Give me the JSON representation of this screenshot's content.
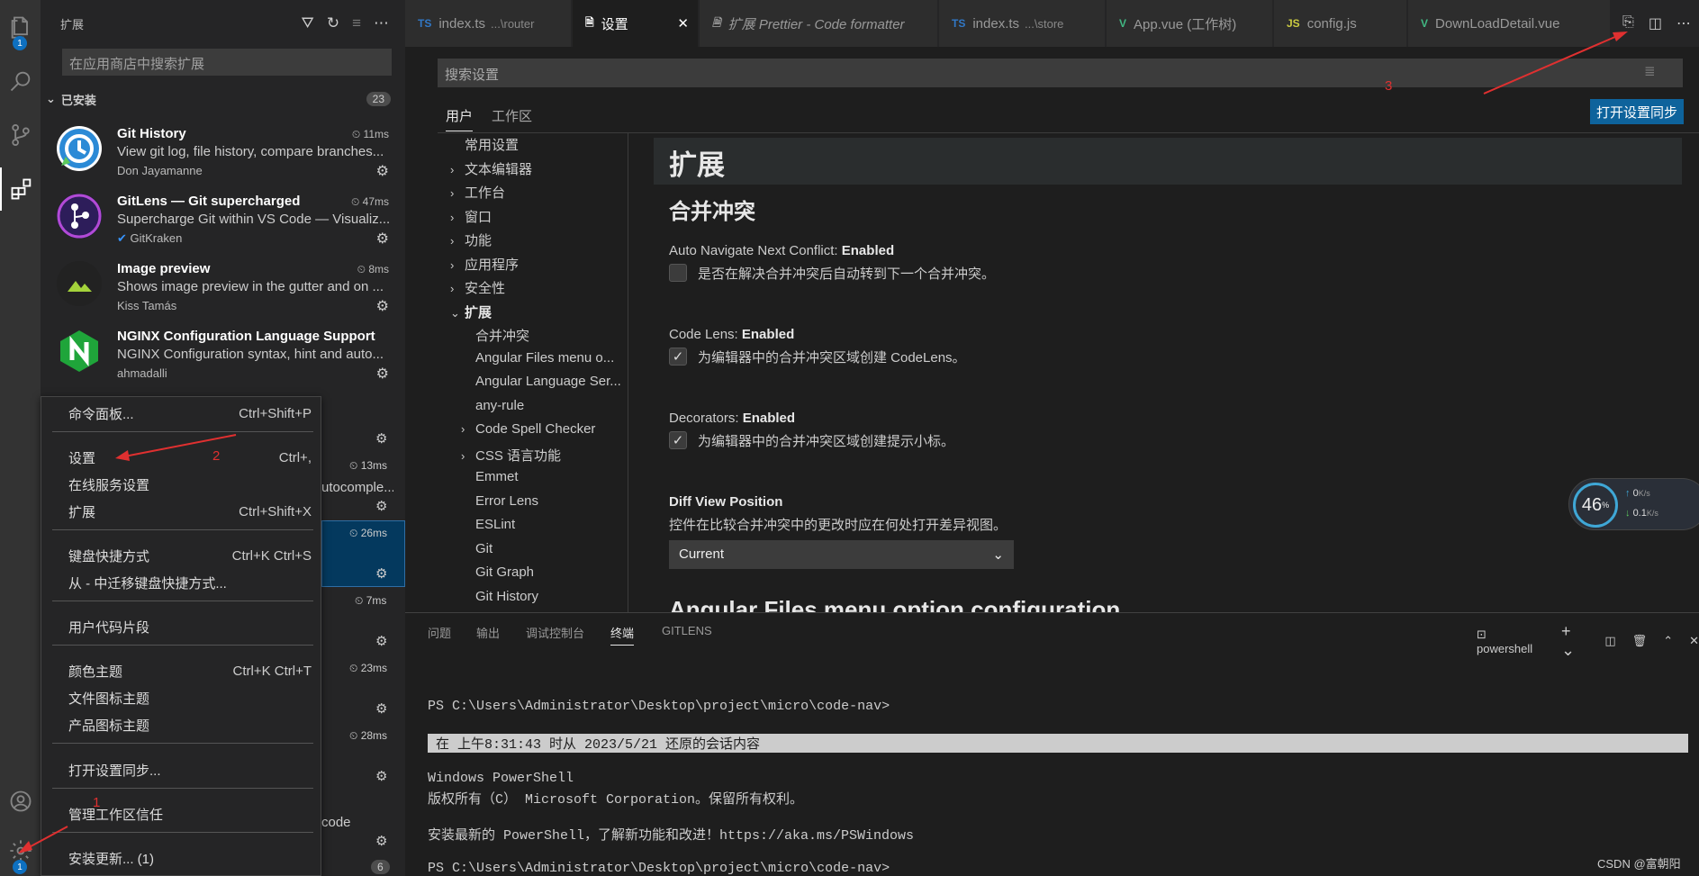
{
  "activity_bar": {
    "explorer_badge": "1",
    "settings_badge": "1"
  },
  "sidebar": {
    "title": "扩展",
    "search_placeholder": "在应用商店中搜索扩展",
    "installed_label": "已安装",
    "installed_count": "23",
    "bottom_count": "6",
    "extensions": [
      {
        "name": "Git History",
        "desc": "View git log, file history, compare branches...",
        "publisher": "Don Jayamanne",
        "time": "11ms"
      },
      {
        "name": "GitLens — Git supercharged",
        "desc": "Supercharge Git within VS Code — Visualiz...",
        "publisher": "GitKraken",
        "time": "47ms"
      },
      {
        "name": "Image preview",
        "desc": "Shows image preview in the gutter and on ...",
        "publisher": "Kiss Tamás",
        "time": "8ms"
      },
      {
        "name": "NGINX Configuration Language Support",
        "desc": "NGINX Configuration syntax, hint and auto...",
        "publisher": "ahmadalli",
        "time": ""
      }
    ],
    "partial_times": [
      "13ms",
      "26ms",
      "7ms",
      "23ms",
      "28ms"
    ],
    "partial_text_1": "utocomple...",
    "partial_text_2": "code"
  },
  "context_menu": {
    "items": [
      {
        "label": "命令面板...",
        "key": "Ctrl+Shift+P"
      },
      {
        "label": "设置",
        "key": "Ctrl+,"
      },
      {
        "label": "在线服务设置",
        "key": ""
      },
      {
        "label": "扩展",
        "key": "Ctrl+Shift+X"
      },
      {
        "label": "键盘快捷方式",
        "key": "Ctrl+K Ctrl+S"
      },
      {
        "label": "从 - 中迁移键盘快捷方式...",
        "key": ""
      },
      {
        "label": "用户代码片段",
        "key": ""
      },
      {
        "label": "颜色主题",
        "key": "Ctrl+K Ctrl+T"
      },
      {
        "label": "文件图标主题",
        "key": ""
      },
      {
        "label": "产品图标主题",
        "key": ""
      },
      {
        "label": "打开设置同步...",
        "key": ""
      },
      {
        "label": "管理工作区信任",
        "key": ""
      },
      {
        "label": "安装更新... (1)",
        "key": ""
      }
    ]
  },
  "tabs": [
    {
      "icon": "TS",
      "label": "index.ts",
      "sub": "...\\router"
    },
    {
      "icon": "",
      "label": "设置",
      "sub": ""
    },
    {
      "icon": "",
      "label": "扩展 Prettier - Code formatter",
      "sub": ""
    },
    {
      "icon": "TS",
      "label": "index.ts",
      "sub": "...\\store"
    },
    {
      "icon": "V",
      "label": "App.vue (工作树)",
      "sub": ""
    },
    {
      "icon": "JS",
      "label": "config.js",
      "sub": ""
    },
    {
      "icon": "V",
      "label": "DownLoadDetail.vue",
      "sub": ""
    }
  ],
  "settings": {
    "search_placeholder": "搜索设置",
    "scope_user": "用户",
    "scope_workspace": "工作区",
    "sync_button": "打开设置同步",
    "toc": [
      {
        "label": "常用设置",
        "chev": ""
      },
      {
        "label": "文本编辑器",
        "chev": "›"
      },
      {
        "label": "工作台",
        "chev": "›"
      },
      {
        "label": "窗口",
        "chev": "›"
      },
      {
        "label": "功能",
        "chev": "›"
      },
      {
        "label": "应用程序",
        "chev": "›"
      },
      {
        "label": "安全性",
        "chev": "›"
      },
      {
        "label": "扩展",
        "chev": "⌄"
      }
    ],
    "toc_sub": [
      {
        "label": "合并冲突",
        "chev": ""
      },
      {
        "label": "Angular Files menu o...",
        "chev": ""
      },
      {
        "label": "Angular Language Ser...",
        "chev": ""
      },
      {
        "label": "any-rule",
        "chev": ""
      },
      {
        "label": "Code Spell Checker",
        "chev": "›"
      },
      {
        "label": "CSS 语言功能",
        "chev": "›"
      },
      {
        "label": "Emmet",
        "chev": ""
      },
      {
        "label": "Error Lens",
        "chev": ""
      },
      {
        "label": "ESLint",
        "chev": ""
      },
      {
        "label": "Git",
        "chev": ""
      },
      {
        "label": "Git Graph",
        "chev": ""
      },
      {
        "label": "Git History",
        "chev": ""
      }
    ],
    "heading": "扩展",
    "section": "合并冲突",
    "s1_title": "Auto Navigate Next Conflict: ",
    "s1_state": "Enabled",
    "s1_desc": "是否在解决合并冲突后自动转到下一个合并冲突。",
    "s2_title": "Code Lens: ",
    "s2_state": "Enabled",
    "s2_desc": "为编辑器中的合并冲突区域创建 CodeLens。",
    "s3_title": "Decorators: ",
    "s3_state": "Enabled",
    "s3_desc": "为编辑器中的合并冲突区域创建提示小标。",
    "s4_title": "Diff View Position",
    "s4_desc": "控件在比较合并冲突中的更改时应在何处打开差异视图。",
    "s4_value": "Current",
    "next_section": "Angular Files menu option configuration"
  },
  "panel": {
    "tabs": [
      "问题",
      "输出",
      "调试控制台",
      "终端",
      "GITLENS"
    ],
    "shell": "powershell",
    "lines": [
      "PS C:\\Users\\Administrator\\Desktop\\project\\micro\\code-nav>",
      " 在 上午8:31:43 时从 2023/5/21 还原的会话内容",
      "Windows PowerShell",
      "版权所有（C） Microsoft Corporation。保留所有权利。",
      "安装最新的 PowerShell，了解新功能和改进！https://aka.ms/PSWindows",
      "PS C:\\Users\\Administrator\\Desktop\\project\\micro\\code-nav>"
    ]
  },
  "annotations": [
    "1",
    "2",
    "3"
  ],
  "net_widget": {
    "percent": "46",
    "up": "0",
    "down": "0.1",
    "unit": "K/s"
  },
  "watermark": "CSDN @富朝阳"
}
